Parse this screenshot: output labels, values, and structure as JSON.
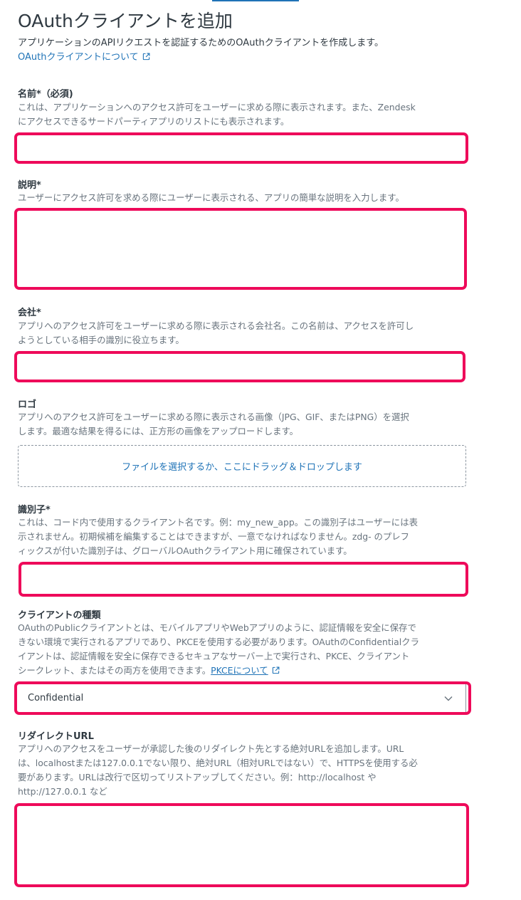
{
  "header": {
    "title": "OAuthクライアントを追加",
    "description": "アプリケーションのAPIリクエストを認証するためのOAuthクライアントを作成します。",
    "help_link": "OAuthクライアントについて"
  },
  "fields": {
    "name": {
      "label": "名前*（必須)",
      "hint": [
        "これは、アプリケーションへのアクセス許可をユーザーに求める際に表示されます。また、Zendesk",
        "にアクセスできるサードパーティアプリのリストにも表示されます。"
      ],
      "value": ""
    },
    "description": {
      "label": "説明*",
      "hint": [
        "ユーザーにアクセス許可を求める際にユーザーに表示される、アプリの簡単な説明を入力します。"
      ],
      "value": ""
    },
    "company": {
      "label": "会社*",
      "hint": [
        "アプリへのアクセス許可をユーザーに求める際に表示される会社名。この名前は、アクセスを許可し",
        "ようとしている相手の識別に役立ちます。"
      ],
      "value": ""
    },
    "logo": {
      "label": "ロゴ",
      "hint": [
        "アプリへのアクセス許可をユーザーに求める際に表示される画像（JPG、GIF、またはPNG）を選択",
        "します。最適な結果を得るには、正方形の画像をアップロードします。"
      ],
      "dropzone": "ファイルを選択するか、ここにドラッグ＆ドロップします"
    },
    "identifier": {
      "label": "識別子*",
      "hint": [
        "これは、コード内で使用するクライアント名です。例：my_new_app。この識別子はユーザーには表",
        "示されません。初期候補を編集することはできますが、一意でなければなりません。zdg- のプレフ",
        "ィックスが付いた識別子は、グローバルOAuthクライアント用に確保されています。"
      ],
      "value": ""
    },
    "client_type": {
      "label": "クライアントの種類",
      "hint": [
        "OAuthのPublicクライアントとは、モバイルアプリやWebアプリのように、認証情報を安全に保存で",
        "きない環境で実行されるアプリであり、PKCEを使用する必要があります。OAuthのConfidentialクラ",
        "イアントは、認証情報を安全に保存できるセキュアなサーバー上で実行され、PKCE、クライアント",
        "シークレット、またはその両方を使用できます。"
      ],
      "pkce_link": "PKCEについて",
      "selected": "Confidential"
    },
    "redirect_url": {
      "label": "リダイレクトURL",
      "hint": [
        "アプリへのアクセスをユーザーが承認した後のリダイレクト先とする絶対URLを追加します。URL",
        "は、localhostまたは127.0.0.1でない限り、絶対URL（相対URLではない）で、HTTPSを使用する必",
        "要があります。URLは改行で区切ってリストアップしてください。例：http://localhost や",
        "http://127.0.0.1 など"
      ],
      "value": ""
    }
  },
  "colors": {
    "link": "#1f73b7",
    "highlight_border": "#ee0a5a",
    "text": "#2f3941",
    "hint_text": "#68737d"
  },
  "icons": [
    "external-link-icon",
    "chevron-down-icon"
  ]
}
